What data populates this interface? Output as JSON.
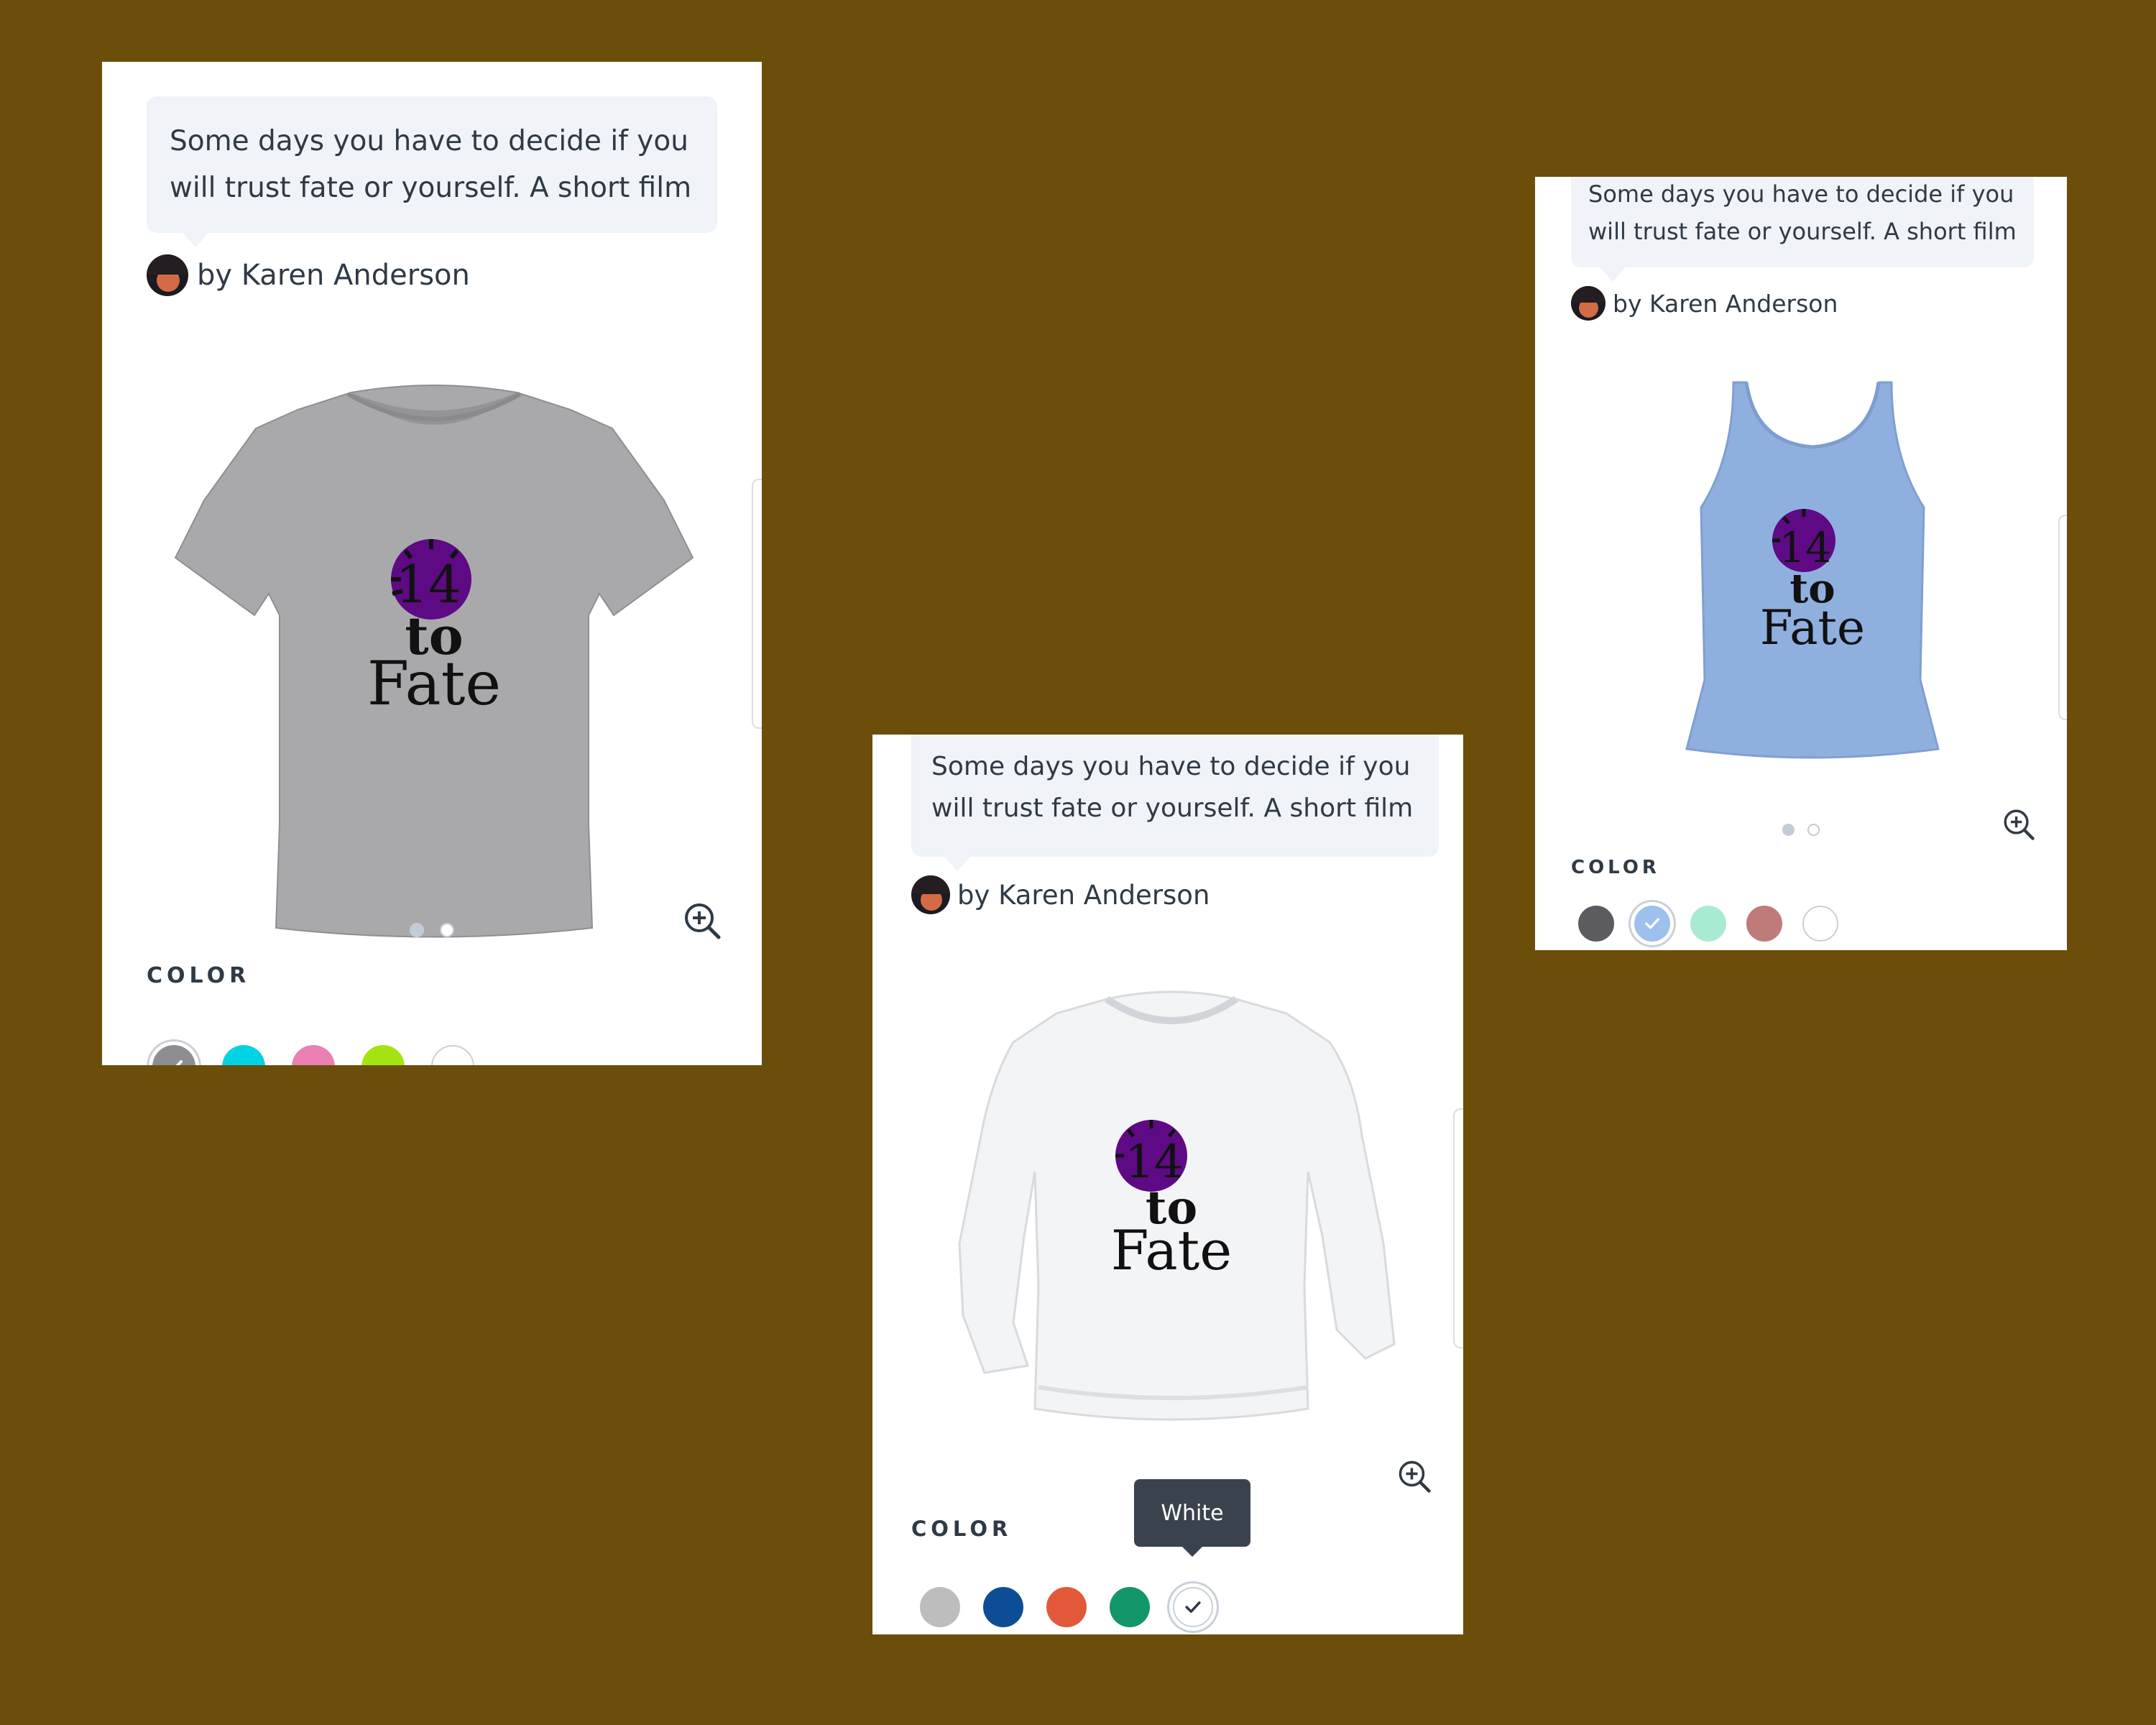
{
  "cards": [
    {
      "id": "tshirt",
      "description": "Some days you have to decide if you will trust fate or yourself. A short film",
      "description_lines": [
        "Some days you have to decide if you",
        "will trust fate or yourself. A short film"
      ],
      "author": "by Karen Anderson",
      "garment": "t-shirt",
      "garment_color": "#a9a9ab",
      "design": {
        "number": "14",
        "line2": "to",
        "line3": "Fate",
        "disc_color": "#5e0a84"
      },
      "pagination": {
        "current": 1,
        "total": 2
      },
      "color_label": "COLOR",
      "swatches": [
        {
          "color": "#8e8e92",
          "selected": true
        },
        {
          "color": "#00d4e4",
          "selected": false
        },
        {
          "color": "#ea7fb3",
          "selected": false
        },
        {
          "color": "#a6e313",
          "selected": false
        },
        {
          "color": "#ffffff",
          "selected": false
        }
      ]
    },
    {
      "id": "sweatshirt",
      "description": "Some days you have to decide if you will trust fate or yourself. A short film",
      "description_lines": [
        "Some days you have to decide if you",
        "will trust fate or yourself. A short film"
      ],
      "author": "by Karen Anderson",
      "garment": "crewneck sweatshirt",
      "garment_color": "#f3f4f6",
      "design": {
        "number": "14",
        "line2": "to",
        "line3": "Fate",
        "disc_color": "#5e0a84"
      },
      "color_label": "COLOR",
      "tooltip": "White",
      "swatches": [
        {
          "color": "#bdbdbd",
          "selected": false
        },
        {
          "color": "#0d4d95",
          "selected": false
        },
        {
          "color": "#e2593a",
          "selected": false
        },
        {
          "color": "#12966a",
          "selected": false
        },
        {
          "color": "#ffffff",
          "selected": true
        }
      ]
    },
    {
      "id": "tank",
      "description": "Some days you have to decide if you will trust fate or yourself. A short film",
      "description_lines": [
        "Some days you have to decide if you",
        "will trust fate or yourself. A short film"
      ],
      "author": "by Karen Anderson",
      "garment": "tank top",
      "garment_color": "#8fb0df",
      "design": {
        "number": "14",
        "line2": "to",
        "line3": "Fate",
        "disc_color": "#5e0a84"
      },
      "pagination": {
        "current": 1,
        "total": 2
      },
      "color_label": "COLOR",
      "swatches": [
        {
          "color": "#5b5b60",
          "selected": false
        },
        {
          "color": "#9ec0ee",
          "selected": true
        },
        {
          "color": "#a9ead3",
          "selected": false
        },
        {
          "color": "#bf7b78",
          "selected": false
        },
        {
          "color": "#ffffff",
          "selected": false
        }
      ]
    }
  ],
  "icons": {
    "zoom": "zoom-in-icon",
    "check": "check-icon"
  }
}
